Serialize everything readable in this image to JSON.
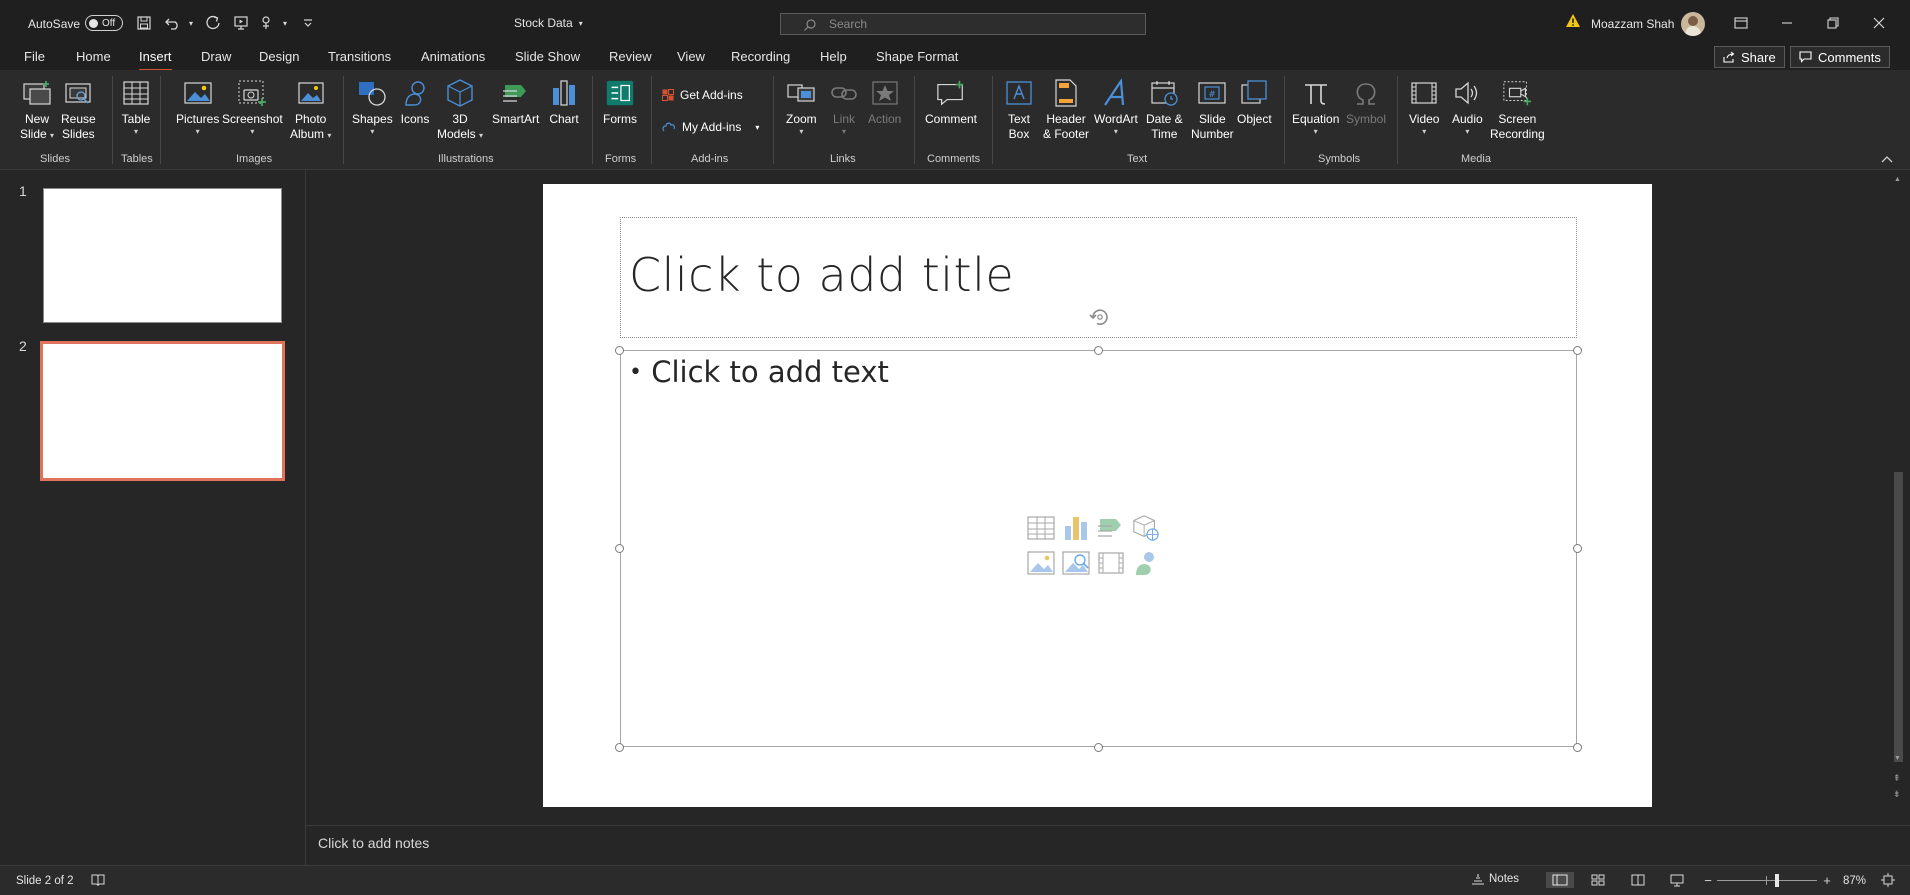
{
  "titlebar": {
    "autosave_label": "AutoSave",
    "autosave_state": "Off",
    "document_title": "Stock Data",
    "search_placeholder": "Search",
    "user_name": "Moazzam Shah"
  },
  "tabs": {
    "items": [
      "File",
      "Home",
      "Insert",
      "Draw",
      "Design",
      "Transitions",
      "Animations",
      "Slide Show",
      "Review",
      "View",
      "Recording",
      "Help",
      "Shape Format"
    ],
    "active": "Insert",
    "share_label": "Share",
    "comments_label": "Comments"
  },
  "ribbon": {
    "new_slide": [
      "New",
      "Slide"
    ],
    "reuse_slides": [
      "Reuse",
      "Slides"
    ],
    "table": "Table",
    "pictures": "Pictures",
    "screenshot": "Screenshot",
    "photo_album": [
      "Photo",
      "Album"
    ],
    "shapes": "Shapes",
    "icons": "Icons",
    "models_3d": [
      "3D",
      "Models"
    ],
    "smartart": "SmartArt",
    "chart": "Chart",
    "forms": "Forms",
    "get_addins": "Get Add-ins",
    "my_addins": "My Add-ins",
    "zoom": "Zoom",
    "link": "Link",
    "action": "Action",
    "comment": "Comment",
    "text_box": [
      "Text",
      "Box"
    ],
    "header_footer": [
      "Header",
      "& Footer"
    ],
    "wordart": "WordArt",
    "date_time": [
      "Date &",
      "Time"
    ],
    "slide_number": [
      "Slide",
      "Number"
    ],
    "object": "Object",
    "equation": "Equation",
    "symbol": "Symbol",
    "video": "Video",
    "audio": "Audio",
    "screen_recording": [
      "Screen",
      "Recording"
    ],
    "groups": {
      "slides": "Slides",
      "tables": "Tables",
      "images": "Images",
      "illustrations": "Illustrations",
      "forms": "Forms",
      "addins": "Add-ins",
      "links": "Links",
      "comments": "Comments",
      "text": "Text",
      "symbols": "Symbols",
      "media": "Media"
    }
  },
  "thumbnails": [
    {
      "number": "1",
      "selected": false
    },
    {
      "number": "2",
      "selected": true
    }
  ],
  "slide": {
    "title_placeholder": "Click to add title",
    "body_placeholder": "Click to add text",
    "bullet": "•"
  },
  "notes": {
    "placeholder": "Click to add notes"
  },
  "status": {
    "slide_indicator": "Slide 2 of 2",
    "notes_label": "Notes",
    "zoom_level": "87%",
    "zoom_fraction": 0.6
  },
  "colors": {
    "accent": "#d35230",
    "titlebar_bg": "#1f1f1f",
    "ribbon_bg": "#2b2b2b",
    "app_bg": "#262626"
  }
}
